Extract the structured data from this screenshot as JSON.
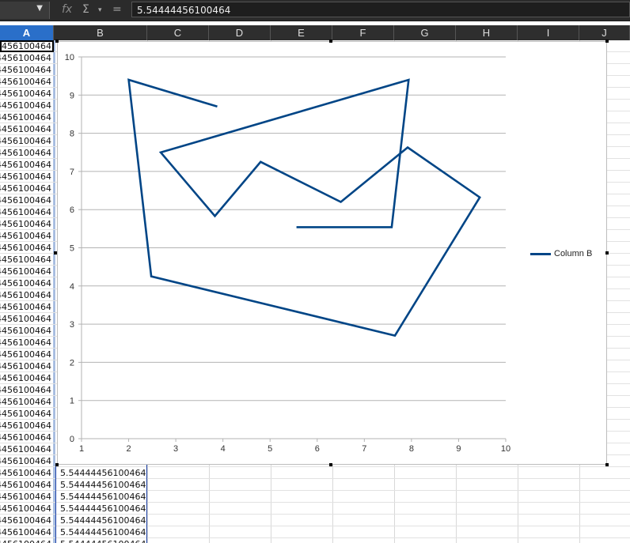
{
  "formula_bar": {
    "namebox": "",
    "namebox_arrow": "▼",
    "fx_icon": "fx",
    "sum_icon": "Σ",
    "dropdown_icon": "▾",
    "equals_icon": "=",
    "content": "5.54444456100464"
  },
  "columns": [
    "A",
    "B",
    "C",
    "D",
    "E",
    "F",
    "G",
    "H",
    "I",
    "J"
  ],
  "selected_column": "A",
  "cell_value": "5.54444456100464",
  "cell_value_truncated": "4456100464",
  "visible_rows": 43,
  "accent_color": "#004586",
  "chart_data": {
    "type": "line",
    "title": "",
    "xlabel": "",
    "ylabel": "",
    "xlim": [
      1,
      10
    ],
    "ylim": [
      0,
      10
    ],
    "x_ticks": [
      "1",
      "2",
      "3",
      "4",
      "5",
      "6",
      "7",
      "8",
      "9",
      "10"
    ],
    "y_ticks": [
      "0",
      "1",
      "2",
      "3",
      "4",
      "5",
      "6",
      "7",
      "8",
      "9",
      "10"
    ],
    "grid": "horizontal",
    "legend_position": "right",
    "series": [
      {
        "name": "Column B",
        "color": "#004586",
        "points": [
          [
            3.88,
            8.7
          ],
          [
            2.0,
            9.4
          ],
          [
            2.48,
            4.25
          ],
          [
            7.65,
            2.7
          ],
          [
            9.45,
            6.32
          ],
          [
            7.92,
            7.63
          ],
          [
            6.5,
            6.2
          ],
          [
            4.8,
            7.25
          ],
          [
            3.83,
            5.83
          ],
          [
            2.68,
            7.5
          ],
          [
            7.94,
            9.4
          ],
          [
            7.58,
            5.54
          ],
          [
            5.56,
            5.54
          ]
        ]
      }
    ]
  }
}
